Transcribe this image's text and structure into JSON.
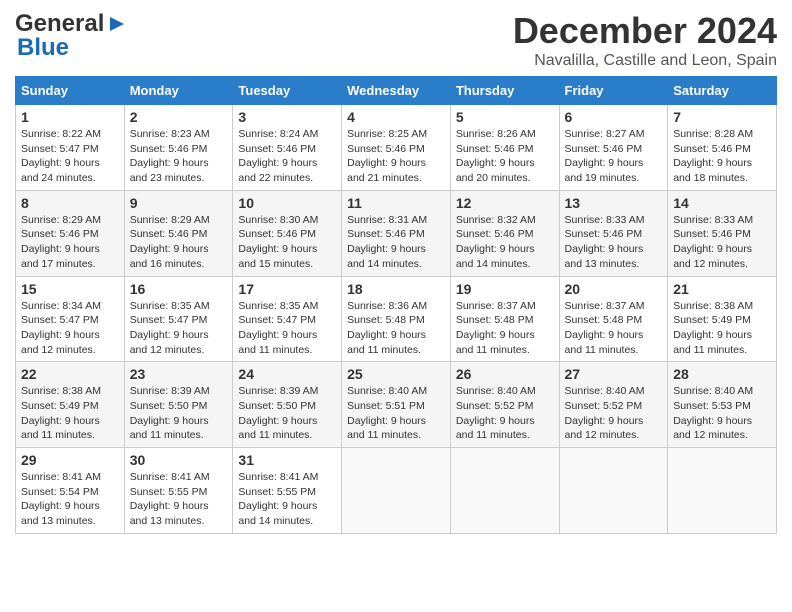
{
  "header": {
    "logo_line1": "General",
    "logo_line2": "Blue",
    "month_title": "December 2024",
    "location": "Navalilla, Castille and Leon, Spain"
  },
  "weekdays": [
    "Sunday",
    "Monday",
    "Tuesday",
    "Wednesday",
    "Thursday",
    "Friday",
    "Saturday"
  ],
  "weeks": [
    [
      {
        "day": "1",
        "text": "Sunrise: 8:22 AM\nSunset: 5:47 PM\nDaylight: 9 hours\nand 24 minutes."
      },
      {
        "day": "2",
        "text": "Sunrise: 8:23 AM\nSunset: 5:46 PM\nDaylight: 9 hours\nand 23 minutes."
      },
      {
        "day": "3",
        "text": "Sunrise: 8:24 AM\nSunset: 5:46 PM\nDaylight: 9 hours\nand 22 minutes."
      },
      {
        "day": "4",
        "text": "Sunrise: 8:25 AM\nSunset: 5:46 PM\nDaylight: 9 hours\nand 21 minutes."
      },
      {
        "day": "5",
        "text": "Sunrise: 8:26 AM\nSunset: 5:46 PM\nDaylight: 9 hours\nand 20 minutes."
      },
      {
        "day": "6",
        "text": "Sunrise: 8:27 AM\nSunset: 5:46 PM\nDaylight: 9 hours\nand 19 minutes."
      },
      {
        "day": "7",
        "text": "Sunrise: 8:28 AM\nSunset: 5:46 PM\nDaylight: 9 hours\nand 18 minutes."
      }
    ],
    [
      {
        "day": "8",
        "text": "Sunrise: 8:29 AM\nSunset: 5:46 PM\nDaylight: 9 hours\nand 17 minutes."
      },
      {
        "day": "9",
        "text": "Sunrise: 8:29 AM\nSunset: 5:46 PM\nDaylight: 9 hours\nand 16 minutes."
      },
      {
        "day": "10",
        "text": "Sunrise: 8:30 AM\nSunset: 5:46 PM\nDaylight: 9 hours\nand 15 minutes."
      },
      {
        "day": "11",
        "text": "Sunrise: 8:31 AM\nSunset: 5:46 PM\nDaylight: 9 hours\nand 14 minutes."
      },
      {
        "day": "12",
        "text": "Sunrise: 8:32 AM\nSunset: 5:46 PM\nDaylight: 9 hours\nand 14 minutes."
      },
      {
        "day": "13",
        "text": "Sunrise: 8:33 AM\nSunset: 5:46 PM\nDaylight: 9 hours\nand 13 minutes."
      },
      {
        "day": "14",
        "text": "Sunrise: 8:33 AM\nSunset: 5:46 PM\nDaylight: 9 hours\nand 12 minutes."
      }
    ],
    [
      {
        "day": "15",
        "text": "Sunrise: 8:34 AM\nSunset: 5:47 PM\nDaylight: 9 hours\nand 12 minutes."
      },
      {
        "day": "16",
        "text": "Sunrise: 8:35 AM\nSunset: 5:47 PM\nDaylight: 9 hours\nand 12 minutes."
      },
      {
        "day": "17",
        "text": "Sunrise: 8:35 AM\nSunset: 5:47 PM\nDaylight: 9 hours\nand 11 minutes."
      },
      {
        "day": "18",
        "text": "Sunrise: 8:36 AM\nSunset: 5:48 PM\nDaylight: 9 hours\nand 11 minutes."
      },
      {
        "day": "19",
        "text": "Sunrise: 8:37 AM\nSunset: 5:48 PM\nDaylight: 9 hours\nand 11 minutes."
      },
      {
        "day": "20",
        "text": "Sunrise: 8:37 AM\nSunset: 5:48 PM\nDaylight: 9 hours\nand 11 minutes."
      },
      {
        "day": "21",
        "text": "Sunrise: 8:38 AM\nSunset: 5:49 PM\nDaylight: 9 hours\nand 11 minutes."
      }
    ],
    [
      {
        "day": "22",
        "text": "Sunrise: 8:38 AM\nSunset: 5:49 PM\nDaylight: 9 hours\nand 11 minutes."
      },
      {
        "day": "23",
        "text": "Sunrise: 8:39 AM\nSunset: 5:50 PM\nDaylight: 9 hours\nand 11 minutes."
      },
      {
        "day": "24",
        "text": "Sunrise: 8:39 AM\nSunset: 5:50 PM\nDaylight: 9 hours\nand 11 minutes."
      },
      {
        "day": "25",
        "text": "Sunrise: 8:40 AM\nSunset: 5:51 PM\nDaylight: 9 hours\nand 11 minutes."
      },
      {
        "day": "26",
        "text": "Sunrise: 8:40 AM\nSunset: 5:52 PM\nDaylight: 9 hours\nand 11 minutes."
      },
      {
        "day": "27",
        "text": "Sunrise: 8:40 AM\nSunset: 5:52 PM\nDaylight: 9 hours\nand 12 minutes."
      },
      {
        "day": "28",
        "text": "Sunrise: 8:40 AM\nSunset: 5:53 PM\nDaylight: 9 hours\nand 12 minutes."
      }
    ],
    [
      {
        "day": "29",
        "text": "Sunrise: 8:41 AM\nSunset: 5:54 PM\nDaylight: 9 hours\nand 13 minutes."
      },
      {
        "day": "30",
        "text": "Sunrise: 8:41 AM\nSunset: 5:55 PM\nDaylight: 9 hours\nand 13 minutes."
      },
      {
        "day": "31",
        "text": "Sunrise: 8:41 AM\nSunset: 5:55 PM\nDaylight: 9 hours\nand 14 minutes."
      },
      null,
      null,
      null,
      null
    ]
  ]
}
